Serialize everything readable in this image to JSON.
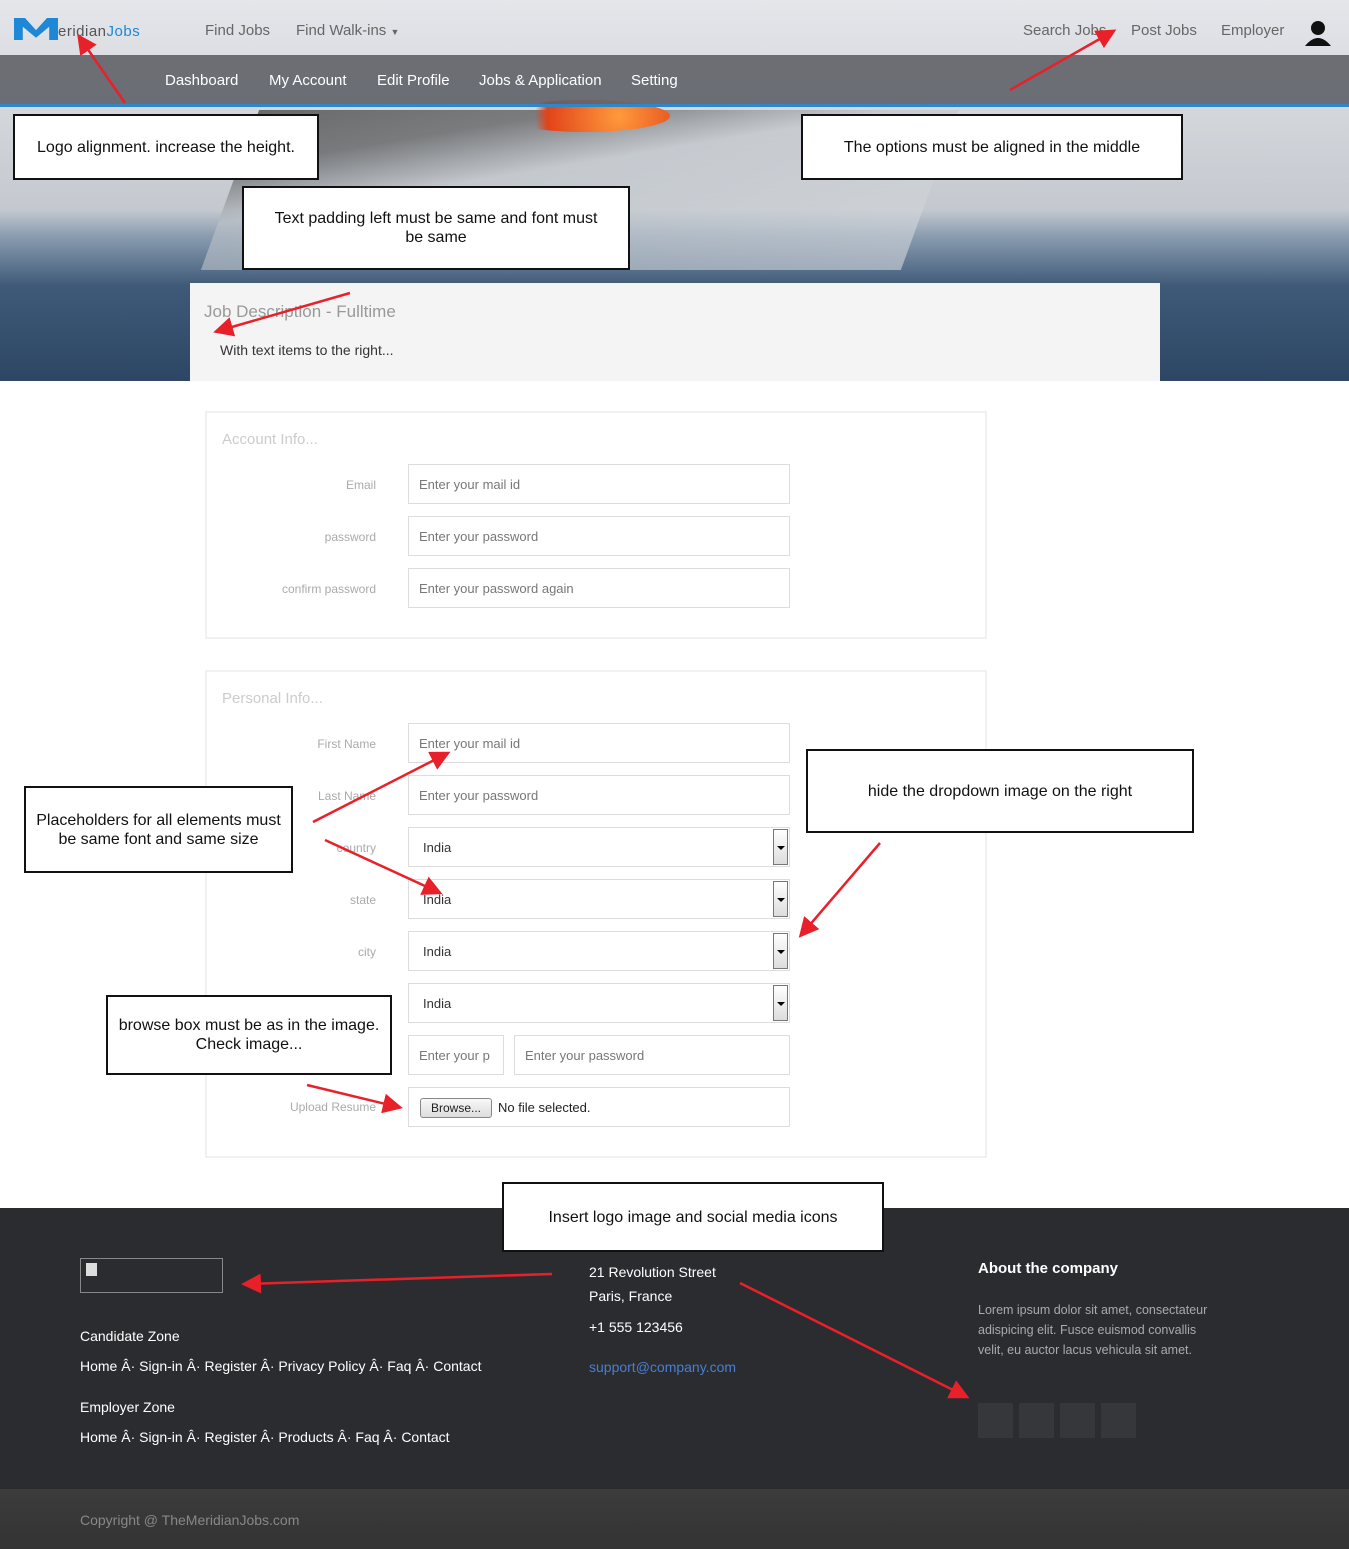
{
  "header": {
    "logo_text": "TheMeridianJobs.com",
    "nav_left": [
      "Find Jobs",
      "Find Walk-ins"
    ],
    "nav_right": [
      "Search Jobs",
      "Post Jobs",
      "Employer"
    ],
    "subnav": [
      "Dashboard",
      "My Account",
      "Edit Profile",
      "Jobs & Application",
      "Setting"
    ]
  },
  "job": {
    "title": "Job Description - Fulltime",
    "subtitle": "With text items to the right..."
  },
  "account": {
    "title": "Account Info...",
    "fields": [
      {
        "label": "Email",
        "placeholder": "Enter your mail id"
      },
      {
        "label": "password",
        "placeholder": "Enter your password"
      },
      {
        "label": "confirm password",
        "placeholder": "Enter your password again"
      }
    ]
  },
  "personal": {
    "title": "Personal Info...",
    "fields": [
      {
        "label": "First Name",
        "placeholder": "Enter your mail id"
      },
      {
        "label": "Last Name",
        "placeholder": "Enter your password"
      }
    ],
    "selects": [
      {
        "label": "country",
        "value": "India"
      },
      {
        "label": "state",
        "value": "India"
      },
      {
        "label": "city",
        "value": "India"
      },
      {
        "label": "",
        "value": "India"
      }
    ],
    "split": [
      "Enter your p",
      "Enter your password"
    ],
    "upload_label": "Upload Resume",
    "browse": "Browse...",
    "no_file": "No file selected."
  },
  "notes": [
    "Logo alignment. increase the height.",
    "The options must be aligned in the middle",
    "Text padding left must be same and font must be same",
    "hide the dropdown image on the right",
    "Placeholders for all elements must be same font and same size",
    "browse box must be as in the image. Check image...",
    "Insert logo image and social media icons"
  ],
  "footer": {
    "candidate_title": "Candidate Zone",
    "candidate_links": "Home Â· Sign-in Â· Register Â· Privacy Policy Â· Faq Â· Contact",
    "employer_title": "Employer Zone",
    "employer_links": "Home Â· Sign-in Â· Register Â· Products Â· Faq Â· Contact",
    "address1": "21 Revolution Street",
    "address2": "Paris, France",
    "phone": "+1 555 123456",
    "email": "support@company.com",
    "about_title": "About the company",
    "about_text": "Lorem ipsum dolor sit amet, consectateur adispicing elit. Fusce euismod convallis velit, eu auctor lacus vehicula sit amet.",
    "copyright": "Copyright @ TheMeridianJobs.com"
  }
}
